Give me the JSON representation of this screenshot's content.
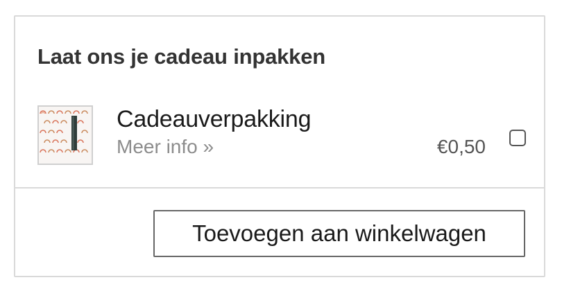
{
  "gift_wrap": {
    "title": "Laat ons je cadeau inpakken",
    "product": {
      "name": "Cadeauverpakking",
      "more_info_link": "Meer info »",
      "price": "€0,50",
      "selected": false,
      "thumbnail_icon": "rainbow-pattern-gift-wrap"
    },
    "add_button_label": "Toevoegen aan winkelwagen"
  },
  "colors": {
    "border": "#d9d9d9",
    "title_text": "#333333",
    "muted_text": "#8c8c8c",
    "price_text": "#555555"
  }
}
